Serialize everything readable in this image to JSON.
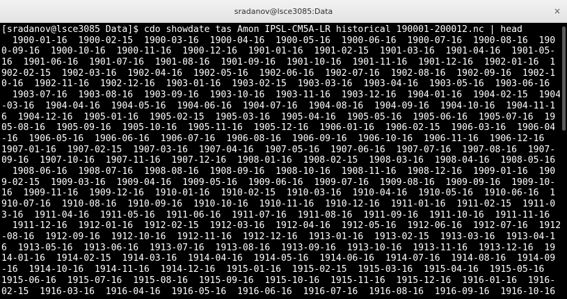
{
  "window": {
    "title": "sradanov@lsce3085:Data",
    "close_icon": "×"
  },
  "terminal": {
    "lines": [
      "[sradanov@lsce3085 Data]$ cdo showdate tas Amon IPSL-CM5A-LR historical 190001-200012.nc | head",
      "  1900-01-16  1900-02-15  1900-03-16  1900-04-16  1900-05-16  1900-06-16  1900-07-16  1900-08-16  190",
      "0-09-16  1900-10-16  1900-11-16  1900-12-16  1901-01-16  1901-02-15  1901-03-16  1901-04-16  1901-05-",
      "16  1901-06-16  1901-07-16  1901-08-16  1901-09-16  1901-10-16  1901-11-16  1901-12-16  1902-01-16  1",
      "902-02-15  1902-03-16  1902-04-16  1902-05-16  1902-06-16  1902-07-16  1902-08-16  1902-09-16  1902-1",
      "0-16  1902-11-16  1902-12-16  1903-01-16  1903-02-15  1903-03-16  1903-04-16  1903-05-16  1903-06-16",
      "  1903-07-16  1903-08-16  1903-09-16  1903-10-16  1903-11-16  1903-12-16  1904-01-16  1904-02-15  1904",
      "-03-16  1904-04-16  1904-05-16  1904-06-16  1904-07-16  1904-08-16  1904-09-16  1904-10-16  1904-11-1",
      "6  1904-12-16  1905-01-16  1905-02-15  1905-03-16  1905-04-16  1905-05-16  1905-06-16  1905-07-16  19",
      "05-08-16  1905-09-16  1905-10-16  1905-11-16  1905-12-16  1906-01-16  1906-02-15  1906-03-16  1906-04",
      "-16  1906-05-16  1906-06-16  1906-07-16  1906-08-16  1906-09-16  1906-10-16  1906-11-16  1906-12-16",
      "1907-01-16  1907-02-15  1907-03-16  1907-04-16  1907-05-16  1907-06-16  1907-07-16  1907-08-16  1907-",
      "09-16  1907-10-16  1907-11-16  1907-12-16  1908-01-16  1908-02-15  1908-03-16  1908-04-16  1908-05-16",
      "  1908-06-16  1908-07-16  1908-08-16  1908-09-16  1908-10-16  1908-11-16  1908-12-16  1909-01-16  190",
      "9-02-15  1909-03-16  1909-04-16  1909-05-16  1909-06-16  1909-07-16  1909-08-16  1909-09-16  1909-10-",
      "16  1909-11-16  1909-12-16  1910-01-16  1910-02-15  1910-03-16  1910-04-16  1910-05-16  1910-06-16  1",
      "910-07-16  1910-08-16  1910-09-16  1910-10-16  1910-11-16  1910-12-16  1911-01-16  1911-02-15  1911-0",
      "3-16  1911-04-16  1911-05-16  1911-06-16  1911-07-16  1911-08-16  1911-09-16  1911-10-16  1911-11-16",
      "  1911-12-16  1912-01-16  1912-02-15  1912-03-16  1912-04-16  1912-05-16  1912-06-16  1912-07-16  1912",
      "-08-16  1912-09-16  1912-10-16  1912-11-16  1912-12-16  1913-01-16  1913-02-15  1913-03-16  1913-04-1",
      "6  1913-05-16  1913-06-16  1913-07-16  1913-08-16  1913-09-16  1913-10-16  1913-11-16  1913-12-16  19",
      "14-01-16  1914-02-15  1914-03-16  1914-04-16  1914-05-16  1914-06-16  1914-07-16  1914-08-16  1914-09",
      "-16  1914-10-16  1914-11-16  1914-12-16  1915-01-16  1915-02-15  1915-03-16  1915-04-16  1915-05-16",
      "1915-06-16  1915-07-16  1915-08-16  1915-09-16  1915-10-16  1915-11-16  1915-12-16  1916-01-16  1916-",
      "02-15  1916-03-16  1916-04-16  1916-05-16  1916-06-16  1916-07-16  1916-08-16  1916-09-16  1916-10-16"
    ]
  },
  "colors": {
    "background": "#000000",
    "text": "#ffffff",
    "titlebar": "#ececec"
  }
}
